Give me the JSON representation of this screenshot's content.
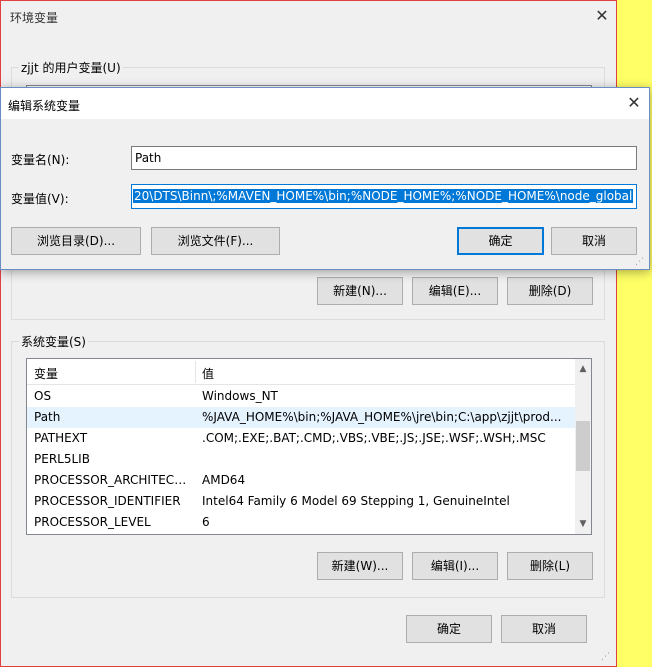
{
  "env_window": {
    "title": "环境变量",
    "user_group_label": "zjjt 的用户变量(U)",
    "user_buttons": {
      "new": "新建(N)...",
      "edit": "编辑(E)...",
      "delete": "删除(D)"
    },
    "system_group_label": "系统变量(S)",
    "system_columns": {
      "name": "变量",
      "value": "值"
    },
    "system_rows": [
      {
        "name": "OS",
        "value": "Windows_NT"
      },
      {
        "name": "Path",
        "value": "%JAVA_HOME%\\bin;%JAVA_HOME%\\jre\\bin;C:\\app\\zjjt\\prod..."
      },
      {
        "name": "PATHEXT",
        "value": ".COM;.EXE;.BAT;.CMD;.VBS;.VBE;.JS;.JSE;.WSF;.WSH;.MSC"
      },
      {
        "name": "PERL5LIB",
        "value": ""
      },
      {
        "name": "PROCESSOR_ARCHITECT...",
        "value": "AMD64"
      },
      {
        "name": "PROCESSOR_IDENTIFIER",
        "value": "Intel64 Family 6 Model 69 Stepping 1, GenuineIntel"
      },
      {
        "name": "PROCESSOR_LEVEL",
        "value": "6"
      }
    ],
    "system_buttons": {
      "new": "新建(W)...",
      "edit": "编辑(I)...",
      "delete": "删除(L)"
    },
    "ok": "确定",
    "cancel": "取消"
  },
  "edit_dialog": {
    "title": "编辑系统变量",
    "name_label": "变量名(N):",
    "name_value": "Path",
    "value_label": "变量值(V):",
    "value_value": "20\\DTS\\Binn\\;%MAVEN_HOME%\\bin;%NODE_HOME%;%NODE_HOME%\\node_global",
    "browse_dir": "浏览目录(D)...",
    "browse_file": "浏览文件(F)...",
    "ok": "确定",
    "cancel": "取消"
  },
  "colors": {
    "accent": "#0078d7",
    "selection_row": "#e5f3ff",
    "backdrop": "#ffff66",
    "window_border": "#e04040"
  }
}
